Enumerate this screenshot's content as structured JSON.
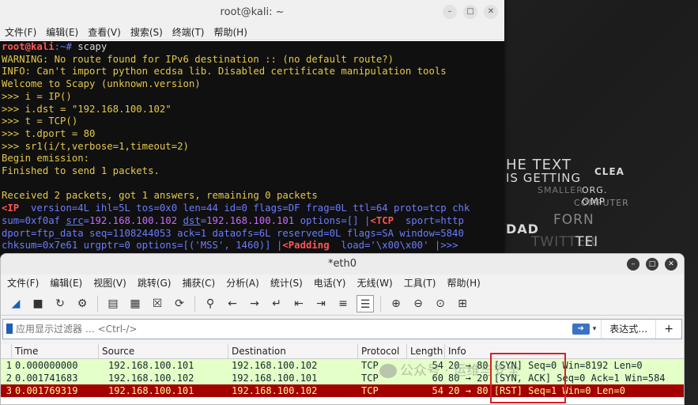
{
  "desktop": {
    "bg_texts": [
      "HE TEXT",
      "IS GETTING",
      "CLEA",
      "SMALLER",
      "ORG.",
      "COMPUTER",
      "DAD",
      "FORN",
      "TWITTER",
      "TEI",
      "OMP"
    ]
  },
  "terminal": {
    "title": "root@kali: ~",
    "menu": [
      "文件(F)",
      "编辑(E)",
      "查看(V)",
      "搜索(S)",
      "终端(T)",
      "帮助(H)"
    ],
    "prompt_user": "root@kali",
    "prompt_rest": ":~# ",
    "command": "scapy",
    "lines": [
      "WARNING: No route found for IPv6 destination :: (no default route?)",
      "INFO: Can't import python ecdsa lib. Disabled certificate manipulation tools",
      "Welcome to Scapy (unknown.version)",
      ">>> i = IP()",
      ">>> i.dst = \"192.168.100.102\"",
      ">>> t = TCP()",
      ">>> t.dport = 80",
      ">>> sr1(i/t,verbose=1,timeout=2)",
      "Begin emission:",
      "Finished to send 1 packets.",
      "",
      "Received 2 packets, got 1 answers, remaining 0 packets"
    ],
    "ip_line": {
      "ip": "<IP",
      "rest": "  version=4L ihl=5L tos=0x0 len=44 id=0 flags=DF frag=0L ttl=64 proto=tcp chk",
      "line2_a": "sum=0xf0af ",
      "src_key": "src",
      "src_val": "192.168.100.102",
      "dst_key": "dst",
      "dst_val": "192.168.100.101",
      "line2_b": " options=[] |",
      "tcp": "<TCP",
      "line2_c": "  sport=http",
      "line3": "dport=ftp_data seq=1108244053 ack=1 dataofs=6L reserved=0L flags=SA window=5840",
      "line4_a": "chksum=0x7e61 urgptr=0 options=[('MSS', 1460)] |",
      "padding": "<Padding",
      "line4_b": "  load='\\x00\\x00' |>>>"
    }
  },
  "wireshark": {
    "title": "*eth0",
    "menu": [
      "文件(F)",
      "编辑(E)",
      "视图(V)",
      "跳转(G)",
      "捕获(C)",
      "分析(A)",
      "统计(S)",
      "电话(Y)",
      "无线(W)",
      "工具(T)",
      "帮助(H)"
    ],
    "filter_placeholder": "应用显示过滤器 … <Ctrl-/>",
    "expression_label": "表达式…",
    "plus_label": "+",
    "columns": [
      "Time",
      "Source",
      "Destination",
      "Protocol",
      "Length",
      "Info"
    ],
    "packets": [
      {
        "no": "1",
        "time": "0.000000000",
        "src": "192.168.100.101",
        "dst": "192.168.100.102",
        "proto": "TCP",
        "len": "54",
        "info": "20 → 80 [SYN] Seq=0 Win=8192 Len=0"
      },
      {
        "no": "2",
        "time": "0.001741683",
        "src": "192.168.100.102",
        "dst": "192.168.100.101",
        "proto": "TCP",
        "len": "60",
        "info": "80 → 20 [SYN, ACK] Seq=0 Ack=1 Win=584"
      },
      {
        "no": "3",
        "time": "0.001769319",
        "src": "192.168.100.101",
        "dst": "192.168.100.102",
        "proto": "TCP",
        "len": "54",
        "info": "20 → 80 [RST] Seq=1 Win=0 Len=0"
      }
    ],
    "watermark": "公众号 · 运维与安全"
  }
}
